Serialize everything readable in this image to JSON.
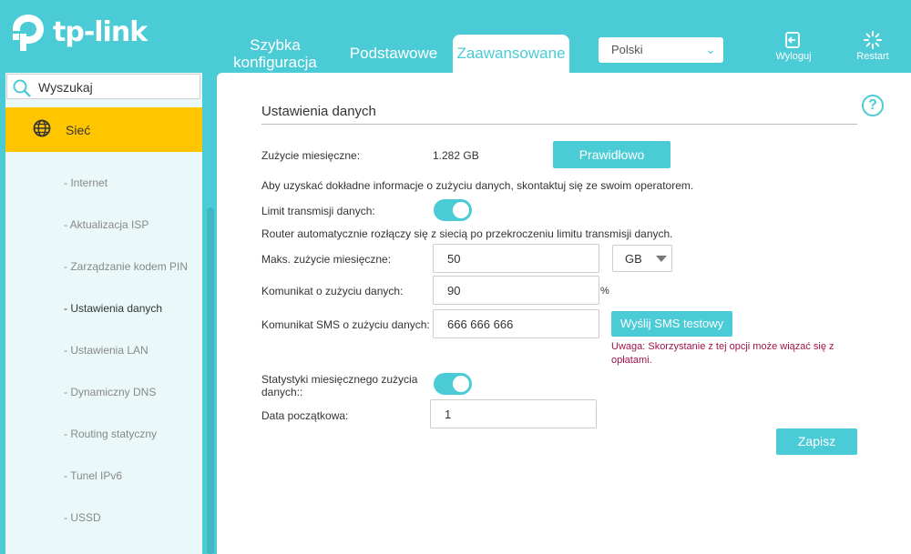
{
  "brand": {
    "name": "tp-link",
    "accent": "#4acbd6",
    "highlight": "#ffc600"
  },
  "header": {
    "tabs": [
      {
        "label": "Szybka konfiguracja"
      },
      {
        "label": "Podstawowe"
      },
      {
        "label": "Zaawansowane"
      }
    ],
    "language": "Polski",
    "logout_label": "Wyloguj",
    "restart_label": "Restart"
  },
  "sidebar": {
    "search_placeholder": "Wyszukaj",
    "active_section": "Sieć",
    "items": [
      "- Internet",
      "- Aktualizacja ISP",
      "- Zarządzanie kodem PIN",
      "- Ustawienia danych",
      "- Ustawienia LAN",
      "- Dynamiczny DNS",
      "- Routing statyczny",
      "- Tunel IPv6",
      "- USSD"
    ],
    "current_item": "- Ustawienia danych"
  },
  "main": {
    "section_title": "Ustawienia danych",
    "monthly_usage_label": "Zużycie miesięczne:",
    "monthly_usage_value": "1.282 GB",
    "valid_button": "Prawidłowo",
    "info_text": "Aby uzyskać dokładne informacje o zużyciu danych, skontaktuj się ze swoim operatorem.",
    "limit_label": "Limit transmisji danych:",
    "limit_enabled": true,
    "limit_info": "Router automatycznie rozłączy się z siecią po przekroczeniu limitu transmisji danych.",
    "max_usage_label": "Maks. zużycie miesięczne:",
    "max_usage_value": "50",
    "max_usage_unit": "GB",
    "usage_alert_label": "Komunikat o zużyciu danych:",
    "usage_alert_value": "90",
    "usage_alert_unit": "%",
    "sms_alert_label": "Komunikat SMS o zużyciu danych:",
    "sms_alert_value": "666 666 666",
    "sms_test_button": "Wyślij SMS testowy",
    "warning_text": "Uwaga: Skorzystanie z tej opcji może wiązać się z opłatami.",
    "monthly_stats_label": "Statystyki miesięcznego zużycia danych::",
    "monthly_stats_enabled": true,
    "start_date_label": "Data początkowa:",
    "start_date_value": "1",
    "save_button": "Zapisz"
  }
}
